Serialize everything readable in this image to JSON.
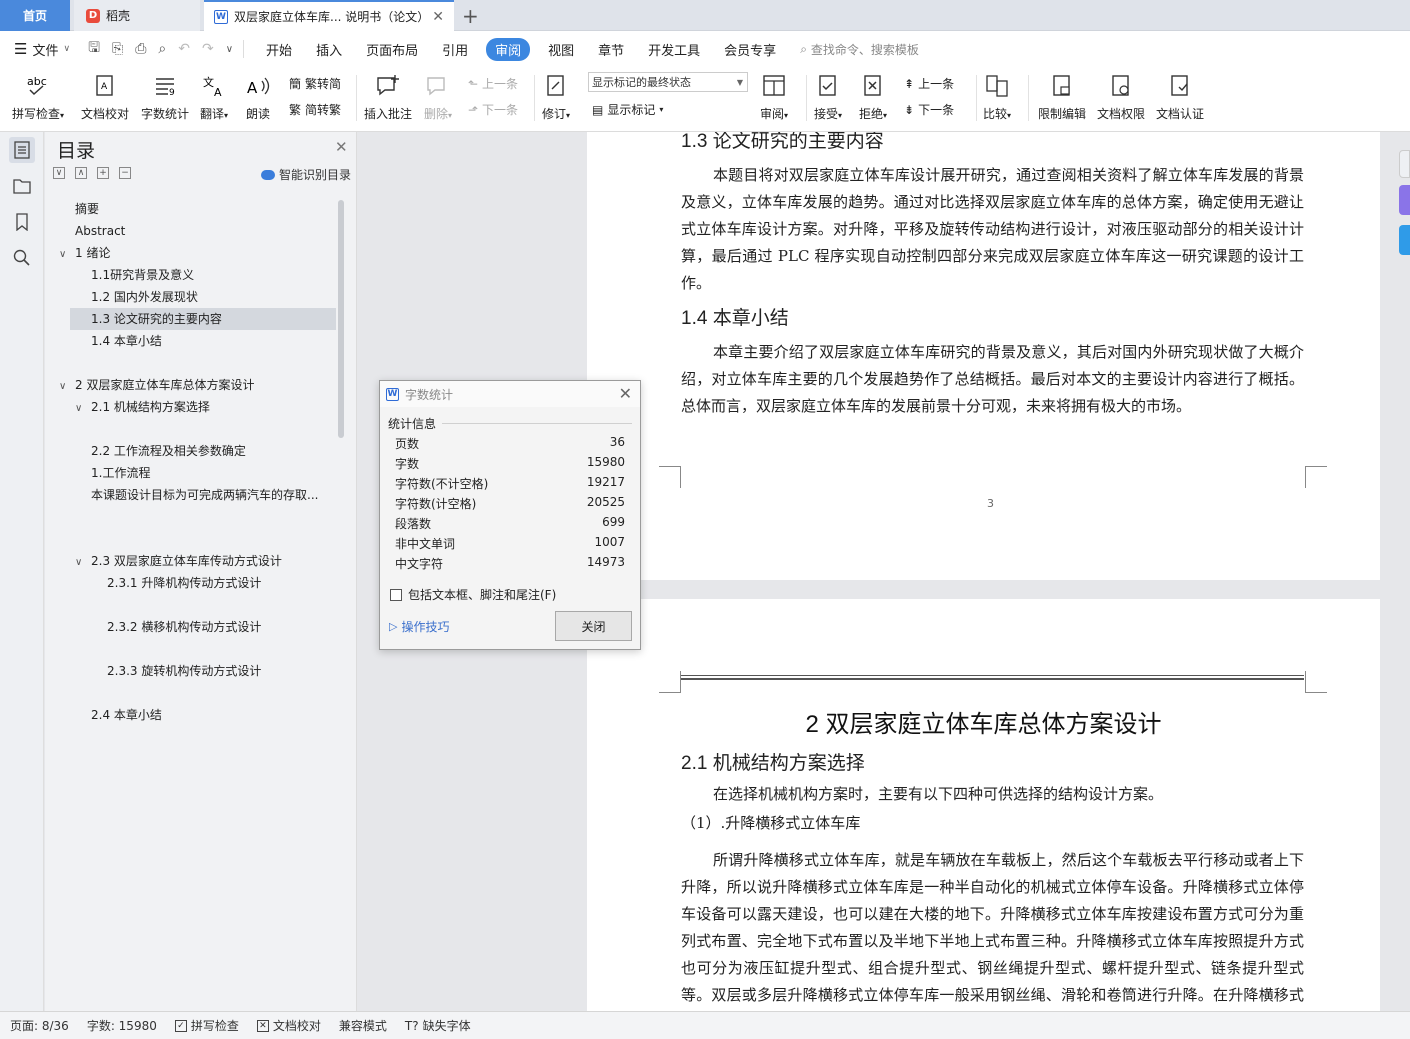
{
  "tabs": {
    "home": "首页",
    "docer": "稻壳",
    "document": "双层家庭立体车库... 说明书（论文）"
  },
  "menubar": {
    "file": "文件",
    "items": [
      "开始",
      "插入",
      "页面布局",
      "引用",
      "审阅",
      "视图",
      "章节",
      "开发工具",
      "会员专享"
    ],
    "active": "审阅",
    "search_placeholder": "查找命令、搜索模板"
  },
  "ribbon": {
    "spellcheck": "拼写检查",
    "doc_proof": "文档校对",
    "word_count": "字数统计",
    "translate": "翻译",
    "read_aloud": "朗读",
    "trad_to_simp": "繁转简",
    "simp_to_trad": "简转繁",
    "insert_comment": "插入批注",
    "delete": "删除",
    "prev": "上一条",
    "next": "下一条",
    "track_changes": "修订",
    "markup_select": "显示标记的最终状态",
    "show_markup": "显示标记",
    "review": "审阅",
    "accept": "接受",
    "reject": "拒绝",
    "prev2": "上一条",
    "next2": "下一条",
    "compare": "比较",
    "restrict_edit": "限制编辑",
    "doc_permission": "文档权限",
    "doc_cert": "文档认证"
  },
  "toc": {
    "title": "目录",
    "smart": "智能识别目录",
    "items": [
      {
        "label": "摘要",
        "level": 1,
        "toggle": ""
      },
      {
        "label": "Abstract",
        "level": 1,
        "toggle": ""
      },
      {
        "label": "1  绪论",
        "level": 1,
        "toggle": "∨"
      },
      {
        "label": "1.1研究背景及意义",
        "level": 2,
        "toggle": ""
      },
      {
        "label": "1.2 国内外发展现状",
        "level": 2,
        "toggle": ""
      },
      {
        "label": "1.3 论文研究的主要内容",
        "level": 2,
        "toggle": "",
        "selected": true
      },
      {
        "label": "1.4 本章小结",
        "level": 2,
        "toggle": ""
      },
      {
        "label": "2  双层家庭立体车库总体方案设计",
        "level": 1,
        "toggle": "∨"
      },
      {
        "label": "2.1 机械结构方案选择",
        "level": 2,
        "toggle": "∨"
      },
      {
        "label": "2.2 工作流程及相关参数确定",
        "level": 2,
        "toggle": ""
      },
      {
        "label": "1.工作流程",
        "level": 2,
        "toggle": ""
      },
      {
        "label": "本课题设计目标为可完成两辆汽车的存取...",
        "level": 2,
        "toggle": ""
      },
      {
        "label": "2.3 双层家庭立体车库传动方式设计",
        "level": 2,
        "toggle": "∨"
      },
      {
        "label": "2.3.1 升降机构传动方式设计",
        "level": 3,
        "toggle": ""
      },
      {
        "label": "2.3.2 横移机构传动方式设计",
        "level": 3,
        "toggle": ""
      },
      {
        "label": "2.3.3 旋转机构传动方式设计",
        "level": 3,
        "toggle": ""
      },
      {
        "label": "2.4 本章小结",
        "level": 2,
        "toggle": ""
      }
    ]
  },
  "document": {
    "page1": {
      "h13": "1.3 论文研究的主要内容",
      "p13": "本题目将对双层家庭立体车库设计展开研究，通过查阅相关资料了解立体车库发展的背景及意义，立体车库发展的趋势。通过对比选择双层家庭立体车库的总体方案，确定使用无避让式立体车库设计方案。对升降，平移及旋转传动结构进行设计，对液压驱动部分的相关设计计算，最后通过 PLC 程序实现自动控制四部分来完成双层家庭立体车库这一研究课题的设计工作。",
      "h14": "1.4 本章小结",
      "p14": "本章主要介绍了双层家庭立体车库研究的背景及意义，其后对国内外研究现状做了大概介绍，对立体车库主要的几个发展趋势作了总结概括。最后对本文的主要设计内容进行了概括。总体而言，双层家庭立体车库的发展前景十分可观，未来将拥有极大的市场。",
      "page_number": "3"
    },
    "page2": {
      "chapter": "2  双层家庭立体车库总体方案设计",
      "h21": "2.1 机械结构方案选择",
      "p_intro": "在选择机械机构方案时，主要有以下四种可供选择的结构设计方案。",
      "p_item": "（1）.升降横移式立体车库",
      "p_body": "所谓升降横移式立体车库，就是车辆放在车载板上，然后这个车载板去平行移动或者上下升降，所以说升降横移式立体车库是一种半自动化的机械式立体停车设备。升降横移式立体停车设备可以露天建设，也可以建在大楼的地下。升降横移式立体车库按建设布置方式可分为重列式布置、完全地下式布置以及半地下半地上式布置三种。升降横移式立体车库按照提升方式也可分为液压缸提升型式、组合提升型式、钢丝绳提升型式、螺杆提升型式、链条提升型式等。双层或多层升降横移式立体停车库一般采用钢丝绳、滑轮和卷筒进行升降。在升降横移式立体车库的整个组成机构中有横移板、升降电机、钢丝绳、交流"
    }
  },
  "word_count_dialog": {
    "title": "字数统计",
    "section": "统计信息",
    "rows": [
      {
        "label": "页数",
        "value": "36"
      },
      {
        "label": "字数",
        "value": "15980"
      },
      {
        "label": "字符数(不计空格)",
        "value": "19217"
      },
      {
        "label": "字符数(计空格)",
        "value": "20525"
      },
      {
        "label": "段落数",
        "value": "699"
      },
      {
        "label": "非中文单词",
        "value": "1007"
      },
      {
        "label": "中文字符",
        "value": "14973"
      }
    ],
    "checkbox": "包括文本框、脚注和尾注(F)",
    "tips": "操作技巧",
    "close": "关闭"
  },
  "statusbar": {
    "page": "页面: 8/36",
    "words": "字数: 15980",
    "spell": "拼写检查",
    "proof": "文档校对",
    "compat": "兼容模式",
    "fonts": "缺失字体"
  }
}
